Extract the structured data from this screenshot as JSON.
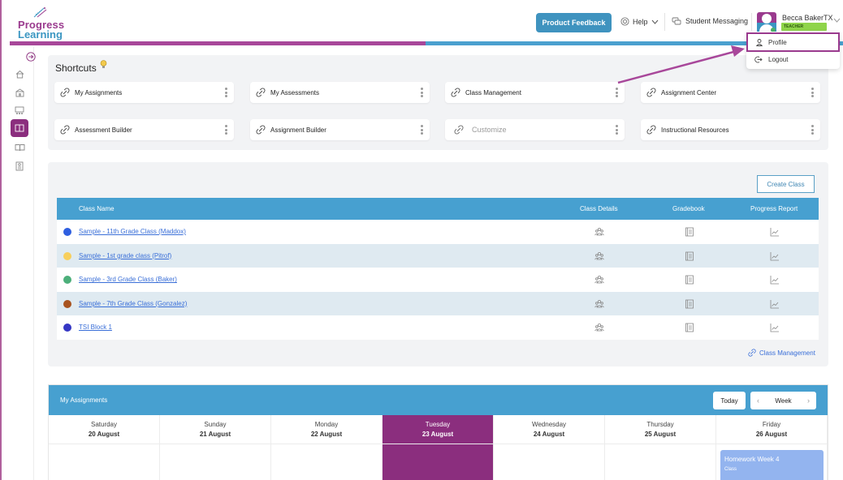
{
  "header": {
    "logo_line1": "Progress",
    "logo_line2": "Learning",
    "product_feedback": "Product Feedback",
    "help": "Help",
    "student_messaging": "Student Messaging",
    "user_name": "Becca BakerTX",
    "user_role": "TEACHER",
    "colors": {
      "brand_purple": "#9a3a8e",
      "brand_blue": "#3b96c2"
    }
  },
  "user_menu": {
    "items": [
      {
        "label": "Profile",
        "icon": "person-icon",
        "highlighted": true
      },
      {
        "label": "Logout",
        "icon": "logout-icon"
      }
    ]
  },
  "sidebar": {
    "items": [
      {
        "icon": "expand-arrow-icon"
      },
      {
        "icon": "home-icon"
      },
      {
        "icon": "school-icon"
      },
      {
        "icon": "classroom-icon"
      },
      {
        "icon": "book-open-icon",
        "active": true
      },
      {
        "icon": "book-icon"
      },
      {
        "icon": "document-icon"
      }
    ]
  },
  "shortcuts": {
    "title": "Shortcuts",
    "items": [
      {
        "label": "My Assignments"
      },
      {
        "label": "My Assessments"
      },
      {
        "label": "Class Management"
      },
      {
        "label": "Assignment Center"
      },
      {
        "label": "Assessment Builder"
      },
      {
        "label": "Assignment Builder"
      },
      {
        "label": "Customize",
        "placeholder": true
      },
      {
        "label": "Instructional Resources"
      }
    ]
  },
  "classes": {
    "create_button": "Create Class",
    "columns": [
      "Class Name",
      "Class Details",
      "Gradebook",
      "Progress Report"
    ],
    "rows": [
      {
        "name": "Sample - 11th Grade Class (Maddox)",
        "color": "#2f5fe0"
      },
      {
        "name": "Sample - 1st grade class (Pitrof)",
        "color": "#f7cf5c"
      },
      {
        "name": "Sample - 3rd Grade Class (Baker)",
        "color": "#4caf7a"
      },
      {
        "name": "Sample - 7th Grade Class (Gonzalez)",
        "color": "#a8531f"
      },
      {
        "name": "TSI Block 1",
        "color": "#3537c4"
      }
    ],
    "footer_link": "Class Management"
  },
  "assignments": {
    "title": "My Assignments",
    "today_button": "Today",
    "view_label": "Week",
    "days": [
      {
        "name": "Saturday",
        "date": "20 August"
      },
      {
        "name": "Sunday",
        "date": "21 August"
      },
      {
        "name": "Monday",
        "date": "22 August"
      },
      {
        "name": "Tuesday",
        "date": "23 August",
        "today": true
      },
      {
        "name": "Wednesday",
        "date": "24 August"
      },
      {
        "name": "Thursday",
        "date": "25 August"
      },
      {
        "name": "Friday",
        "date": "26 August"
      }
    ],
    "events": [
      {
        "day": "Friday",
        "title": "Homework Week 4",
        "subtitle": "Class"
      }
    ]
  }
}
